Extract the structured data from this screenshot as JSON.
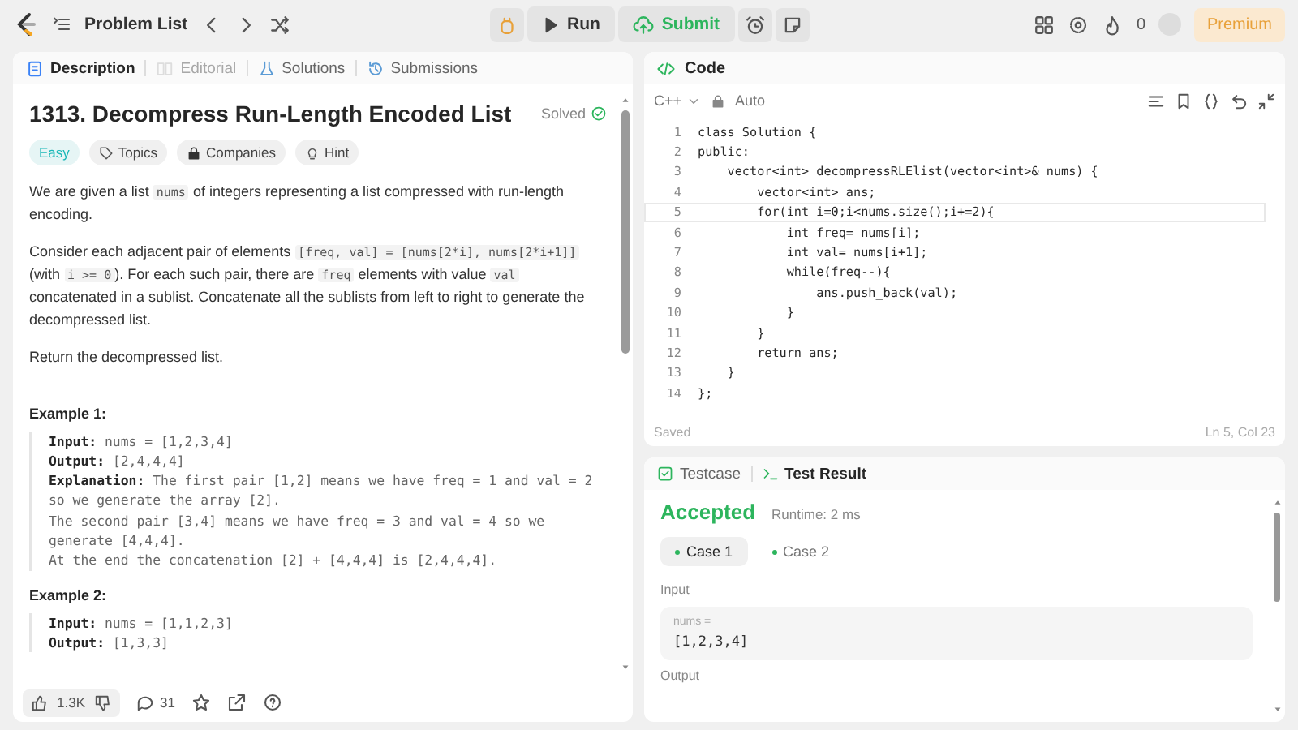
{
  "topbar": {
    "problem_list": "Problem List",
    "run": "Run",
    "submit": "Submit",
    "streak": "0",
    "premium": "Premium"
  },
  "description_tabs": [
    {
      "label": "Description",
      "selected": true,
      "disabled": false
    },
    {
      "label": "Editorial",
      "selected": false,
      "disabled": true
    },
    {
      "label": "Solutions",
      "selected": false,
      "disabled": false
    },
    {
      "label": "Submissions",
      "selected": false,
      "disabled": false
    }
  ],
  "problem": {
    "title": "1313. Decompress Run-Length Encoded List",
    "status": "Solved",
    "difficulty": "Easy",
    "tags": [
      {
        "label": "Topics",
        "kind": "tag"
      },
      {
        "label": "Companies",
        "kind": "lock"
      },
      {
        "label": "Hint",
        "kind": "bulb"
      }
    ],
    "paragraphs": [
      [
        {
          "kind": "text",
          "text": "We are given a list "
        },
        {
          "kind": "code",
          "text": "nums"
        },
        {
          "kind": "text",
          "text": " of integers representing a list compressed with run-length encoding."
        }
      ],
      [
        {
          "kind": "text",
          "text": "Consider each adjacent pair of elements "
        },
        {
          "kind": "code",
          "text": "[freq, val] = [nums[2*i], nums[2*i+1]]"
        },
        {
          "kind": "text",
          "text": " (with "
        },
        {
          "kind": "code",
          "text": "i >= 0"
        },
        {
          "kind": "text",
          "text": "). For each such pair, there are "
        },
        {
          "kind": "code",
          "text": "freq"
        },
        {
          "kind": "text",
          "text": " elements with value "
        },
        {
          "kind": "code",
          "text": "val"
        },
        {
          "kind": "text",
          "text": " concatenated in a sublist. Concatenate all the sublists from left to right to generate the decompressed list."
        }
      ],
      [
        {
          "kind": "text",
          "text": "Return the decompressed list."
        }
      ]
    ],
    "examples": [
      {
        "heading": "Example 1:",
        "lines": [
          "**Input:** nums = [1,2,3,4]",
          "**Output:** [2,4,4,4]",
          "**Explanation:** The first pair [1,2] means we have freq = 1 and val = 2 so we generate the array [2].",
          "The second pair [3,4] means we have freq = 3 and val = 4 so we generate [4,4,4].",
          "At the end the concatenation [2] + [4,4,4] is [2,4,4,4]."
        ]
      },
      {
        "heading": "Example 2:",
        "lines": [
          "**Input:** nums = [1,1,2,3]",
          "**Output:** [1,3,3]"
        ]
      }
    ]
  },
  "reactions": {
    "likes": "1.3K",
    "comments": "31"
  },
  "code_panel": {
    "title": "Code",
    "language": "C++",
    "mode": "Auto",
    "status": "Saved",
    "cursor": "Ln 5, Col 23",
    "lines": [
      {
        "number": "1",
        "text": "class Solution {",
        "current": false
      },
      {
        "number": "2",
        "text": "public:",
        "current": false
      },
      {
        "number": "3",
        "text": "    vector<int> decompressRLElist(vector<int>& nums) {",
        "current": false
      },
      {
        "number": "4",
        "text": "        vector<int> ans;",
        "current": false
      },
      {
        "number": "5",
        "text": "        for(int i=0;i<nums.size();i+=2){",
        "current": true
      },
      {
        "number": "6",
        "text": "            int freq= nums[i];",
        "current": false
      },
      {
        "number": "7",
        "text": "            int val= nums[i+1];",
        "current": false
      },
      {
        "number": "8",
        "text": "            while(freq--){",
        "current": false
      },
      {
        "number": "9",
        "text": "                ans.push_back(val);",
        "current": false
      },
      {
        "number": "10",
        "text": "            }",
        "current": false
      },
      {
        "number": "11",
        "text": "        }",
        "current": false
      },
      {
        "number": "12",
        "text": "        return ans;",
        "current": false
      },
      {
        "number": "13",
        "text": "    }",
        "current": false
      },
      {
        "number": "14",
        "text": "};",
        "current": false
      }
    ]
  },
  "test_panel": {
    "tabs": [
      {
        "label": "Testcase",
        "selected": false
      },
      {
        "label": "Test Result",
        "selected": true
      }
    ],
    "verdict": "Accepted",
    "runtime": "Runtime: 2 ms",
    "cases": [
      {
        "label": "Case 1",
        "selected": true
      },
      {
        "label": "Case 2",
        "selected": false
      }
    ],
    "input_label": "Input",
    "param": "nums =",
    "param_value": "[1,2,3,4]",
    "output_label": "Output"
  }
}
